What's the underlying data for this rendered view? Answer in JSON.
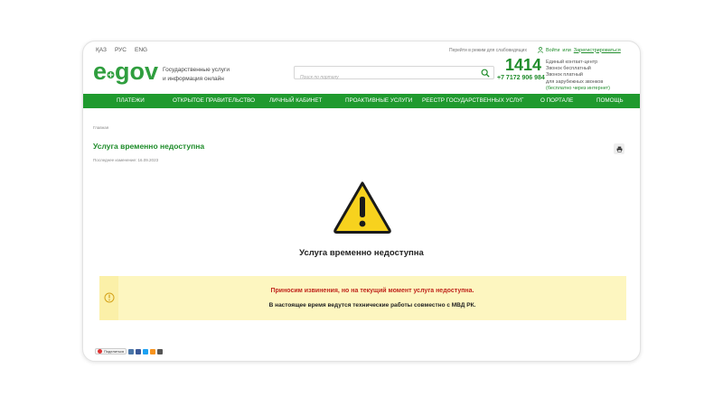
{
  "topbar": {
    "languages": [
      "ҚАЗ",
      "РУС",
      "ENG"
    ],
    "impaired_mode": "Перейти в режим для слабовидящих",
    "login": "Войти",
    "or": "или",
    "register": "Зарегистрироваться"
  },
  "header": {
    "logo": "egov",
    "tagline_1": "Государственные услуги",
    "tagline_2": "и информация онлайн",
    "search_placeholder": "Поиск по порталу",
    "phone_short": "1414",
    "phone_long": "+7 7172 906 984",
    "info_lines": [
      "Единый контакт-центр",
      "Звонок бесплатный",
      "Звонок платный",
      "для зарубежных звонков"
    ],
    "info_link": "(бесплатно через интернет)"
  },
  "nav": {
    "items": [
      "Платежи",
      "Открытое правительство",
      "Личный кабинет",
      "Проактивные услуги",
      "Реестр государственных услуг",
      "О портале",
      "Помощь"
    ]
  },
  "content": {
    "breadcrumb": "Главная",
    "title": "Услуга временно недоступна",
    "last_modified": "Последнее изменение: 16.09.2023",
    "heading": "Услуга временно недоступна",
    "apology": "Приносим извинения, но на текущий момент услуга недоступна.",
    "details": "В настоящее время ведутся технические работы совместно с МВД РК."
  },
  "share": {
    "label": "Поделиться"
  },
  "colors": {
    "brand_green": "#1f9a2e",
    "notice_bg": "#fdf6c0",
    "apology_red": "#c0261c",
    "warning_yellow": "#f7d21e"
  },
  "icons": [
    "user-icon",
    "search-icon",
    "print-icon",
    "warning-icon",
    "info-icon",
    "share-logo-icon"
  ]
}
